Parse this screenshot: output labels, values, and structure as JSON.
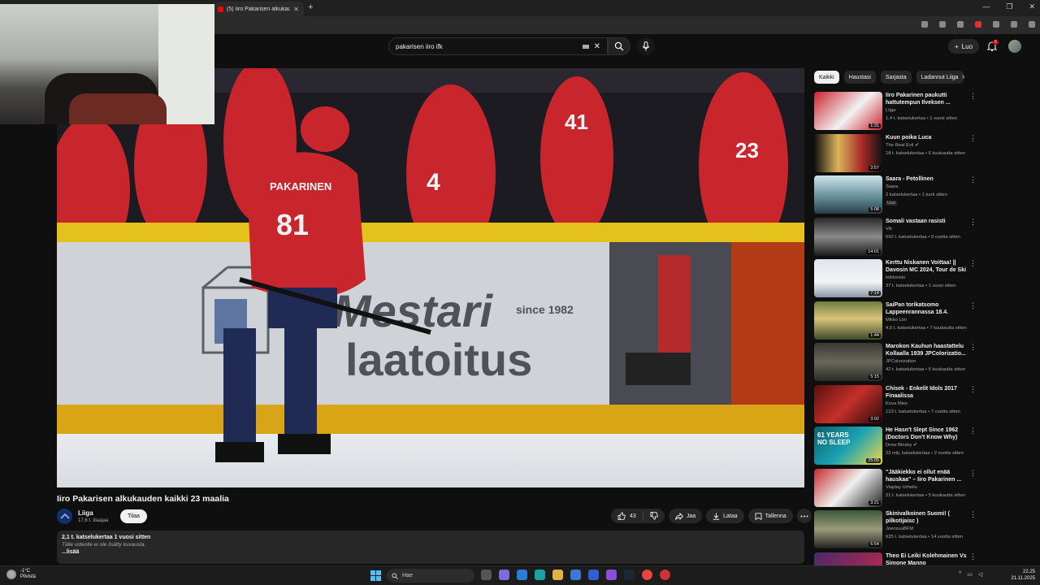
{
  "browser": {
    "tab_title": "(5) Iiro Pakarisen alkukauden k...",
    "tab_close": "✕",
    "new_tab": "+",
    "window_controls": [
      "—",
      "❐",
      "✕"
    ]
  },
  "header": {
    "search_query": "pakarisen iiro ifk",
    "clear": "✕",
    "create_label": "Luo",
    "notification_count": "5"
  },
  "video": {
    "title": "Iiro Pakarisen alkukauden kaikki 23 maalia",
    "channel_name": "Liiga",
    "channel_subs": "17,6 t. tilaajaa",
    "subscribe_label": "Tilaa",
    "likes": "43",
    "share_label": "Jaa",
    "download_label": "Lataa",
    "save_label": "Tallenna",
    "description": {
      "stats": "2,1 t. katselukertaa  1 vuosi sitten",
      "text": "Tälle videolle ei ole lisätty kuvausta.",
      "more": "...lisää"
    },
    "scene_text": {
      "jersey_name": "PAKARINEN",
      "jersey_number": "81",
      "board_top": "Mestari",
      "board_bottom": "laatoitus",
      "board_since": "since 1982"
    }
  },
  "chips": [
    "Kaikki",
    "Haustasi",
    "Sarjasta",
    "Ladannut Liiga"
  ],
  "recommendations": [
    {
      "title": "Iiro Pakarinen paukutti hattutempun Ilveksen ...",
      "channel": "Liiga",
      "meta": "1,4 t. katselukertaa • 1 vuosi sitten",
      "duration": "1:31",
      "verified": false,
      "badge": ""
    },
    {
      "title": "Kuun poika Luca",
      "channel": "The Real Evil",
      "meta": "18 t. katselukertaa • 6 kuukautta sitten",
      "duration": "3:57",
      "verified": true,
      "badge": ""
    },
    {
      "title": "Saara - Petollinen",
      "channel": "Saara",
      "meta": "2 katselukertaa • 1 tunti sitten",
      "duration": "5:08",
      "verified": false,
      "badge": "Uusi"
    },
    {
      "title": "Somali vastaan rasisti",
      "channel": "Vili",
      "meta": "592 t. katselukertaa • 9 vuotta sitten",
      "duration": "14:01",
      "verified": false,
      "badge": ""
    },
    {
      "title": "Kerttu Niskanen Voittaa! || Davosin MC 2024, Tour de Ski",
      "channel": "hiihtoniilo",
      "meta": "37 t. katselukertaa • 1 vuosi sitten",
      "duration": "7:14",
      "verified": false,
      "badge": ""
    },
    {
      "title": "SaiPan torikatsomo Lappeenrannassa 18.4.",
      "channel": "Mikko Liiri",
      "meta": "4,5 t. katselukertaa • 7 kuukautta sitten",
      "duration": "1:44",
      "verified": false,
      "badge": ""
    },
    {
      "title": "Marokon Kauhun haastattelu Kollaalla 1939 JPColorizatio...",
      "channel": "JPColorization",
      "meta": "42 t. katselukertaa • 5 kuukautta sitten",
      "duration": "5:15",
      "verified": false,
      "badge": ""
    },
    {
      "title": "Chisek - Enkelit Idols 2017 Finaalissa",
      "channel": "Kova Mies",
      "meta": "123 t. katselukertaa • 7 vuotta sitten",
      "duration": "3:02",
      "verified": false,
      "badge": ""
    },
    {
      "title": "He Hasn't Slept Since 1962 (Doctors Don't Know Why)",
      "channel": "Drew Binsky",
      "meta": "22 milj. katselukertaa • 2 vuotta sitten",
      "duration": "25:05",
      "verified": true,
      "badge": "",
      "thumb_text": "61 YEARS NO SLEEP"
    },
    {
      "title": "\"Jääkiekko ei ollut enää hauskaa\" – Iiro Pakarinen ...",
      "channel": "Viaplay Urheilu",
      "meta": "21 t. katselukertaa • 5 kuukautta sitten",
      "duration": "3:21",
      "verified": false,
      "badge": ""
    },
    {
      "title": "Skinivalkoinen Suomi! ( pilkotijaisc )",
      "channel": "JoensuuBFM",
      "meta": "635 t. katselukertaa • 14 vuotta sitten",
      "duration": "6:54",
      "verified": false,
      "badge": ""
    },
    {
      "title": "Theo Ei Leiki Kolehmainen Vs Simone Manno",
      "channel": "",
      "meta": "",
      "duration": "",
      "verified": false,
      "badge": ""
    }
  ],
  "taskbar": {
    "weather_temp": "-1°C",
    "weather_text": "Pilvistä",
    "search_placeholder": "Hae",
    "time": "22.25",
    "date": "21.11.2025"
  },
  "colors": {
    "background": "#0f0f0f",
    "accent_red": "#ff0000",
    "chip_bg": "#272727"
  }
}
